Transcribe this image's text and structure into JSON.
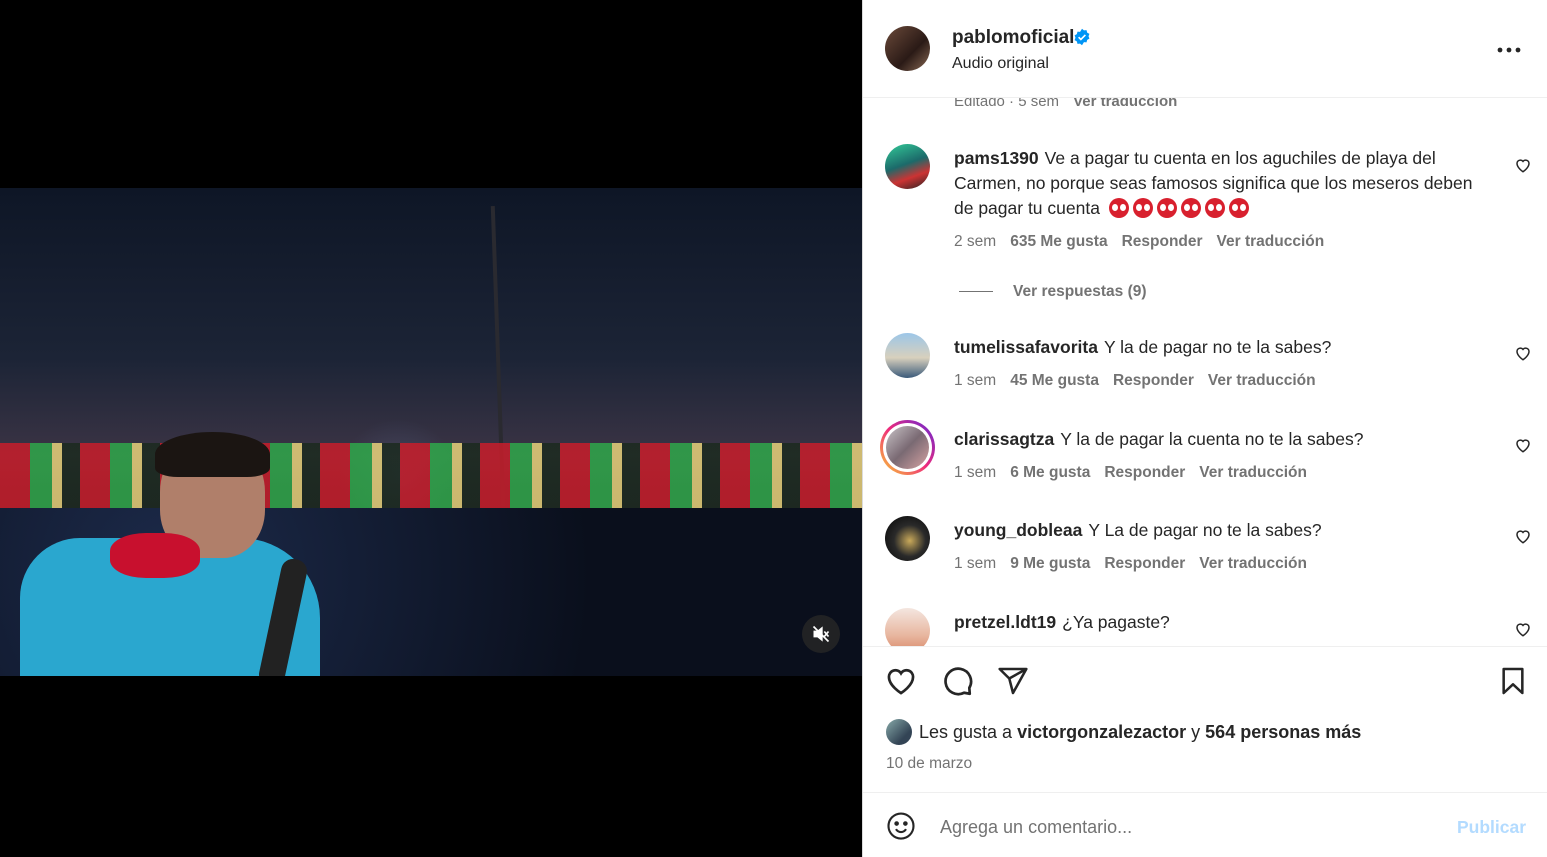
{
  "post": {
    "username": "pablomoficial",
    "audio": "Audio original",
    "edited": "Editado · 5 sem",
    "see_translation": "Ver traducción"
  },
  "comments": [
    {
      "user": "pams1390",
      "text": "Ve a pagar tu cuenta en los aguchiles de playa del Carmen, no porque seas famosos significa que los meseros deben de pagar tu cuenta",
      "time": "2 sem",
      "likes": "635 Me gusta",
      "reply": "Responder",
      "translate": "Ver traducción",
      "view_replies": "Ver respuestas (9)"
    },
    {
      "user": "tumelissafavorita",
      "text": "Y la de pagar no te la sabes?",
      "time": "1 sem",
      "likes": "45 Me gusta",
      "reply": "Responder",
      "translate": "Ver traducción"
    },
    {
      "user": "clarissagtza",
      "text": "Y la de pagar la cuenta no te la sabes?",
      "time": "1 sem",
      "likes": "6 Me gusta",
      "reply": "Responder",
      "translate": "Ver traducción"
    },
    {
      "user": "young_dobleaa",
      "text": "Y La de pagar no te la sabes?",
      "time": "1 sem",
      "likes": "9 Me gusta",
      "reply": "Responder",
      "translate": "Ver traducción"
    },
    {
      "user": "pretzel.ldt19",
      "text": "¿Ya pagaste?"
    }
  ],
  "likes_summary": {
    "prefix": "Les gusta a",
    "user": "victorgonzalezactor",
    "joiner": "y",
    "others": "564 personas más"
  },
  "date": "10 de marzo",
  "add_comment": {
    "placeholder": "Agrega un comentario...",
    "publish": "Publicar"
  },
  "icons": [
    "verified-badge-icon",
    "more-options-icon",
    "muted-speaker-icon",
    "heart-icon",
    "comment-icon",
    "share-icon",
    "bookmark-icon",
    "emoji-icon",
    "eyes-emoji-icon"
  ],
  "colors": {
    "verified": "#0095f6",
    "publish_disabled": "#b3dbff",
    "secondary_text": "#737373"
  }
}
